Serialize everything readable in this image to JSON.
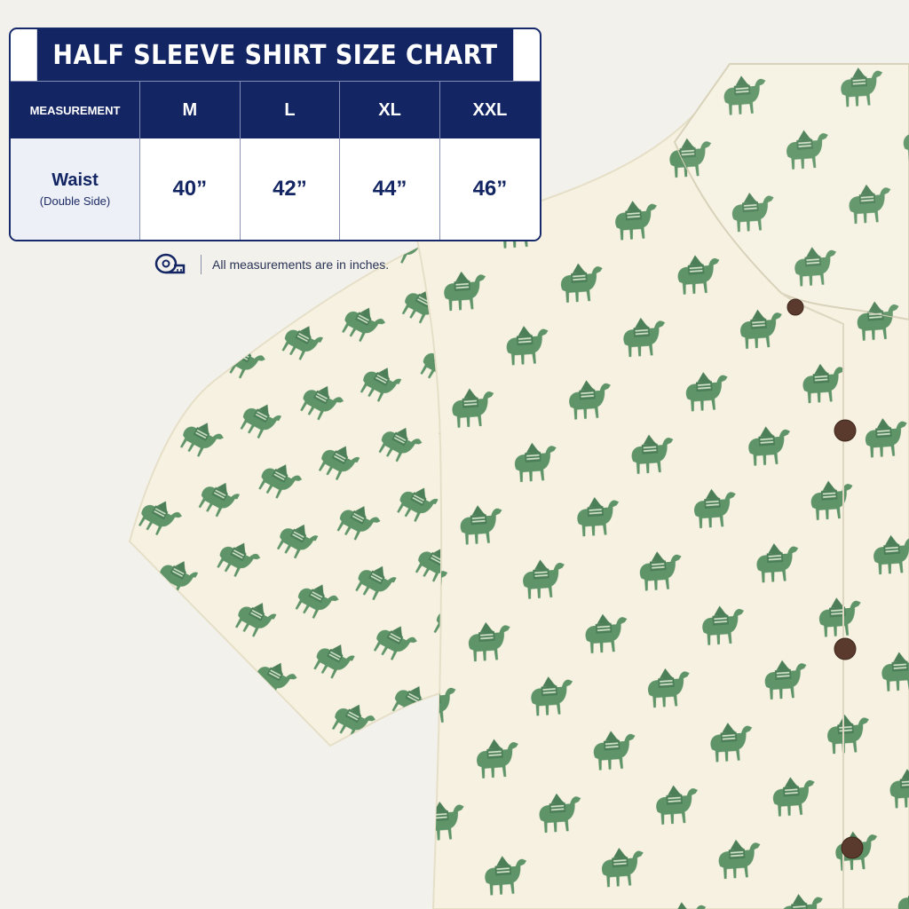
{
  "chart": {
    "title": "HALF SLEEVE SHIRT SIZE CHART",
    "header": [
      "MEASUREMENT",
      "M",
      "L",
      "XL",
      "XXL"
    ],
    "row": {
      "label": "Waist",
      "sublabel": "(Double Side)",
      "values": [
        "40”",
        "42”",
        "44”",
        "46”"
      ]
    }
  },
  "note": {
    "icon": "measuring-tape-icon",
    "text": "All measurements are in inches."
  },
  "colors": {
    "navy": "#132563",
    "fabric": "#f6f1e0",
    "print": "#5e9468",
    "background": "#f3f1ec",
    "button": "#5a3a2c"
  },
  "product": {
    "description_icon": "camel-print-icon"
  }
}
